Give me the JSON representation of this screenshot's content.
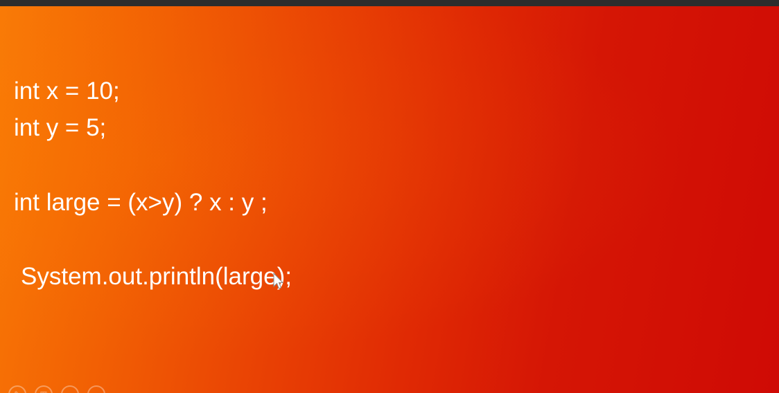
{
  "code": {
    "line1": "int x = 10;",
    "line2": "int y = 5;",
    "line3": "int large = (x>y) ? x : y ;",
    "line4": "System.out.println(large);"
  },
  "controls": [
    {
      "icon": "pen-icon"
    },
    {
      "icon": "slides-grid-icon"
    },
    {
      "icon": "zoom-icon"
    },
    {
      "icon": "more-options-icon"
    }
  ],
  "colors": {
    "slide_left": "#f97a06",
    "slide_right": "#cf0a05",
    "text": "#ffffff"
  }
}
